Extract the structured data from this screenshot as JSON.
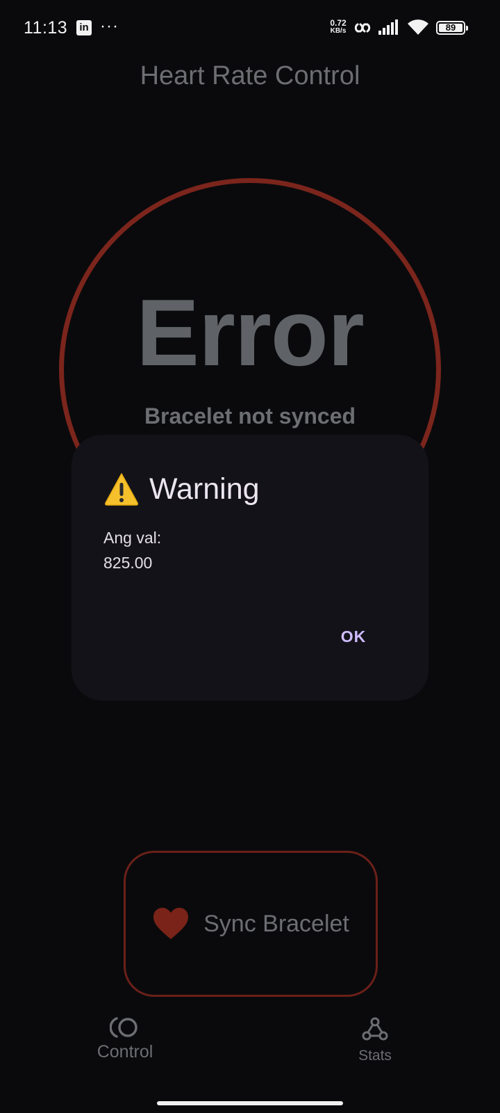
{
  "status_bar": {
    "time": "11:13",
    "notification_app": "in",
    "more_dots": "···",
    "net_speed_value": "0.72",
    "net_speed_unit": "KB/s",
    "battery": "89"
  },
  "app": {
    "title": "Heart Rate Control",
    "reading": "Error",
    "reading_status": "Bracelet not synced"
  },
  "dialog": {
    "title": "Warning",
    "body_line1": "Ang val:",
    "body_line2": "825.00",
    "ok_label": "OK"
  },
  "sync_button": {
    "label": "Sync Bracelet"
  },
  "nav": {
    "items": [
      {
        "label": "Control",
        "icon": "control-icon"
      },
      {
        "label": "Stats",
        "icon": "stats-icon"
      }
    ]
  },
  "colors": {
    "background": "#0a0a0c",
    "ring": "#7b251c",
    "dialog_bg": "#141219",
    "accent": "#cfbcff",
    "muted_text": "#6c6e72"
  }
}
